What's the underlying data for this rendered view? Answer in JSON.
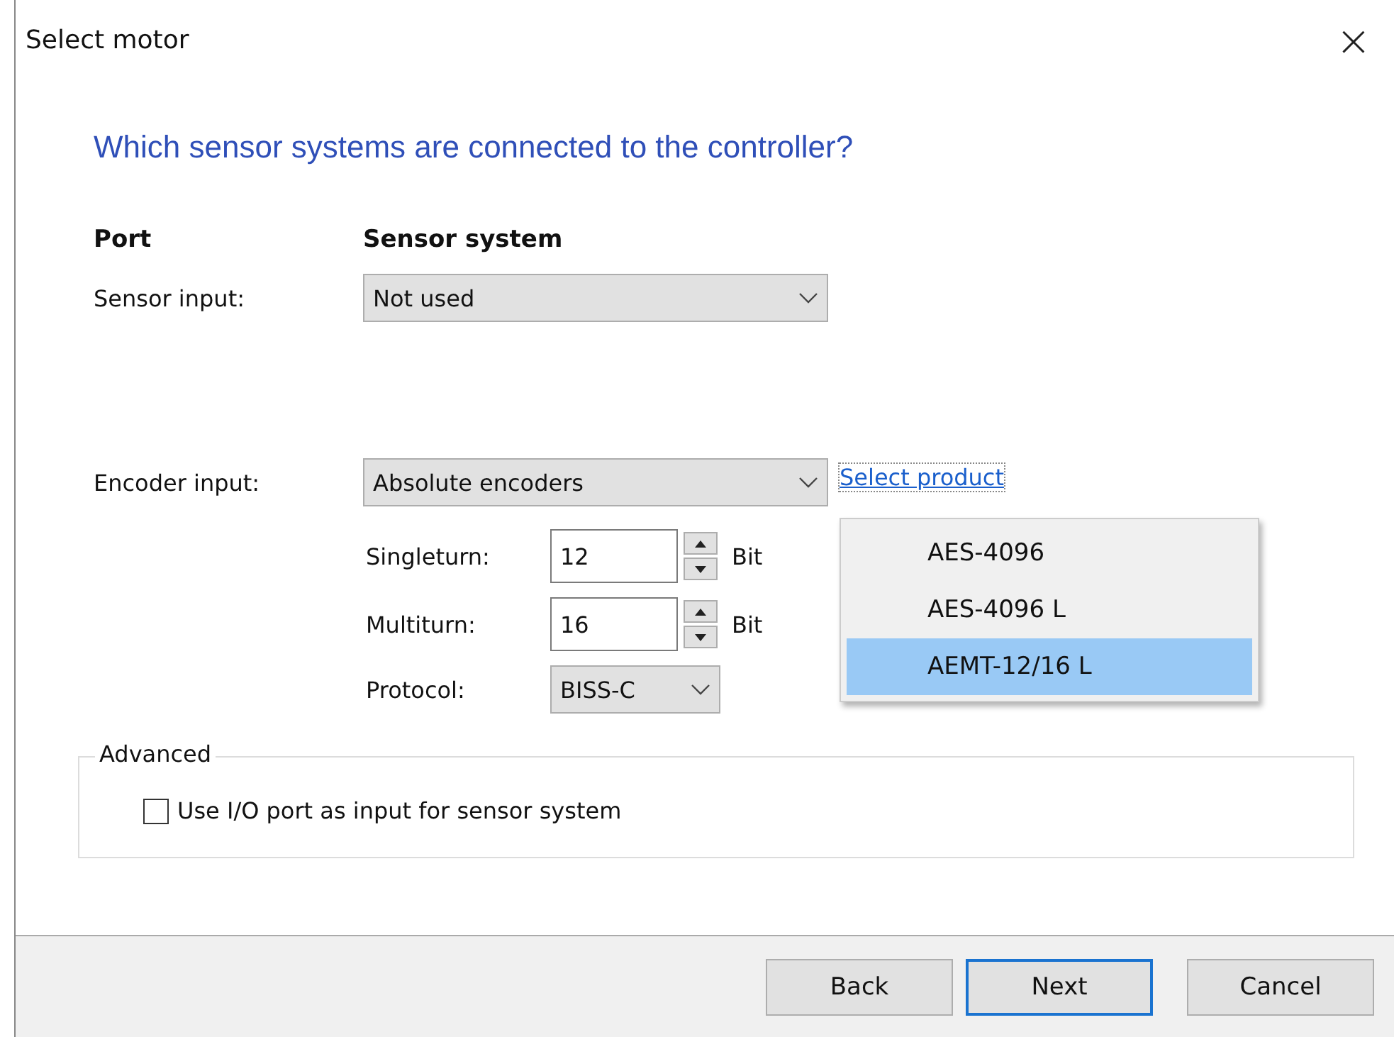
{
  "window": {
    "title": "Select motor",
    "close": "×"
  },
  "heading": "Which sensor systems are connected to the controller?",
  "columns": [
    "Port",
    "Sensor system"
  ],
  "sensor": {
    "label": "Sensor input:",
    "value": "Not used"
  },
  "encoder": {
    "label": "Encoder input:",
    "value": "Absolute encoders",
    "link": "Select product"
  },
  "spinners": [
    {
      "label": "Singleturn:",
      "value": "12",
      "unit": "Bit"
    },
    {
      "label": "Multiturn:",
      "value": "16",
      "unit": "Bit"
    }
  ],
  "protocol": {
    "label": "Protocol:",
    "value": "BISS-C"
  },
  "product_menu": [
    {
      "label": "AES-4096",
      "selected": false
    },
    {
      "label": "AES-4096 L",
      "selected": false
    },
    {
      "label": "AEMT-12/16 L",
      "selected": true
    }
  ],
  "advanced": {
    "title": "Advanced",
    "option": {
      "label": "Use I/O port as input for sensor system",
      "checked": false
    }
  },
  "buttons": [
    {
      "label": "Back",
      "default": false
    },
    {
      "label": "Next",
      "default": true
    },
    {
      "label": "Cancel",
      "default": false
    }
  ]
}
